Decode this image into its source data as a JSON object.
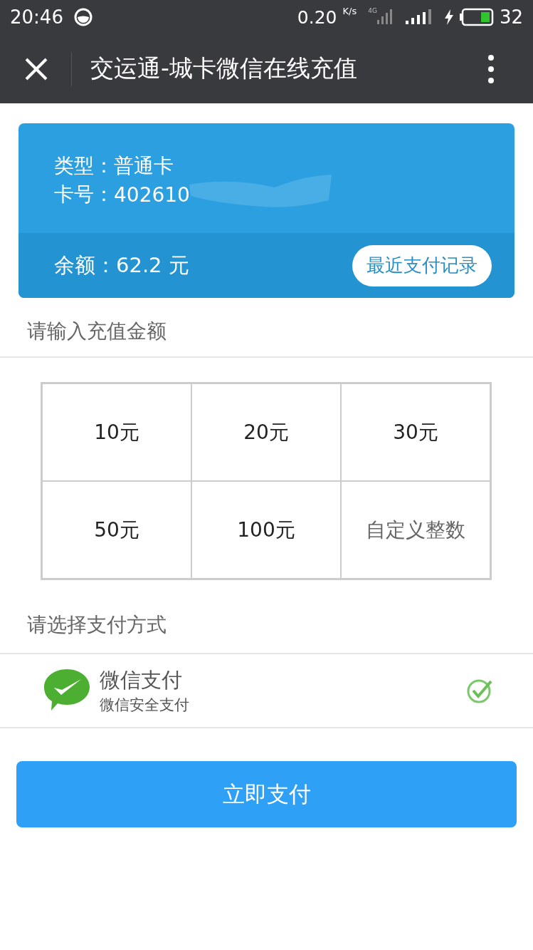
{
  "status_bar": {
    "time": "20:46",
    "speed": "0.20",
    "speed_unit": "K/s",
    "network": "4G",
    "battery": "32"
  },
  "header": {
    "title": "交运通-城卡微信在线充值"
  },
  "card": {
    "type_label": "类型：",
    "type_value": "普通卡",
    "number_label": "卡号：",
    "number_value": "402610",
    "balance_label": "余额：",
    "balance_value": "62.2 元",
    "history_button": "最近支付记录"
  },
  "amount_section": {
    "title": "请输入充值金额"
  },
  "amounts": [
    {
      "label": "10元",
      "kind": "preset"
    },
    {
      "label": "20元",
      "kind": "preset"
    },
    {
      "label": "30元",
      "kind": "preset"
    },
    {
      "label": "50元",
      "kind": "preset"
    },
    {
      "label": "100元",
      "kind": "preset"
    },
    {
      "label": "自定义整数",
      "kind": "custom"
    }
  ],
  "payment_section": {
    "title": "请选择支付方式"
  },
  "payment_methods": [
    {
      "name": "微信支付",
      "subtitle": "微信安全支付",
      "selected": true
    }
  ],
  "pay_button": "立即支付"
}
